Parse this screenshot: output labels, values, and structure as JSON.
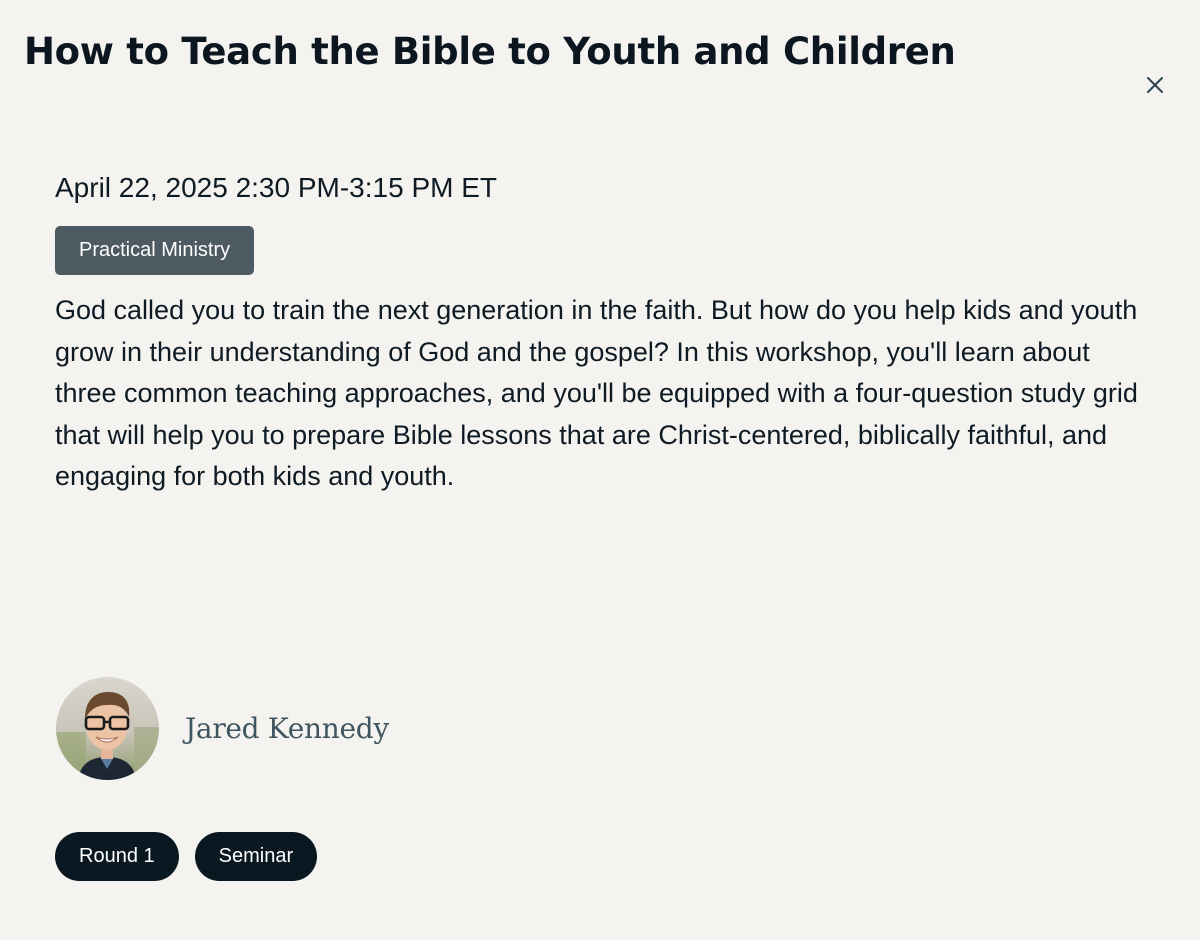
{
  "session": {
    "title": "How to Teach the Bible to Youth and Children",
    "datetime": "April 22, 2025 2:30 PM-3:15 PM ET",
    "category": "Practical Ministry",
    "description": "God called you to train the next generation in the faith. But how do you help kids and youth grow in their understanding of God and the gospel? In this workshop, you'll learn about three common teaching approaches, and you'll be equipped with a four-question study grid that will help you to prepare Bible lessons that are Christ-centered, biblically faithful, and engaging for both kids and youth.",
    "speaker": {
      "name": "Jared Kennedy",
      "avatar_icon": "speaker-photo"
    },
    "tags": [
      "Round 1",
      "Seminar"
    ]
  },
  "icons": {
    "close": "close-icon"
  },
  "colors": {
    "background": "#f5f3ef",
    "text": "#0e1a24",
    "category_tag": "#4e5a62",
    "pill": "#0a1822",
    "speaker_name": "#3f5560",
    "close_icon": "#2d4350"
  }
}
